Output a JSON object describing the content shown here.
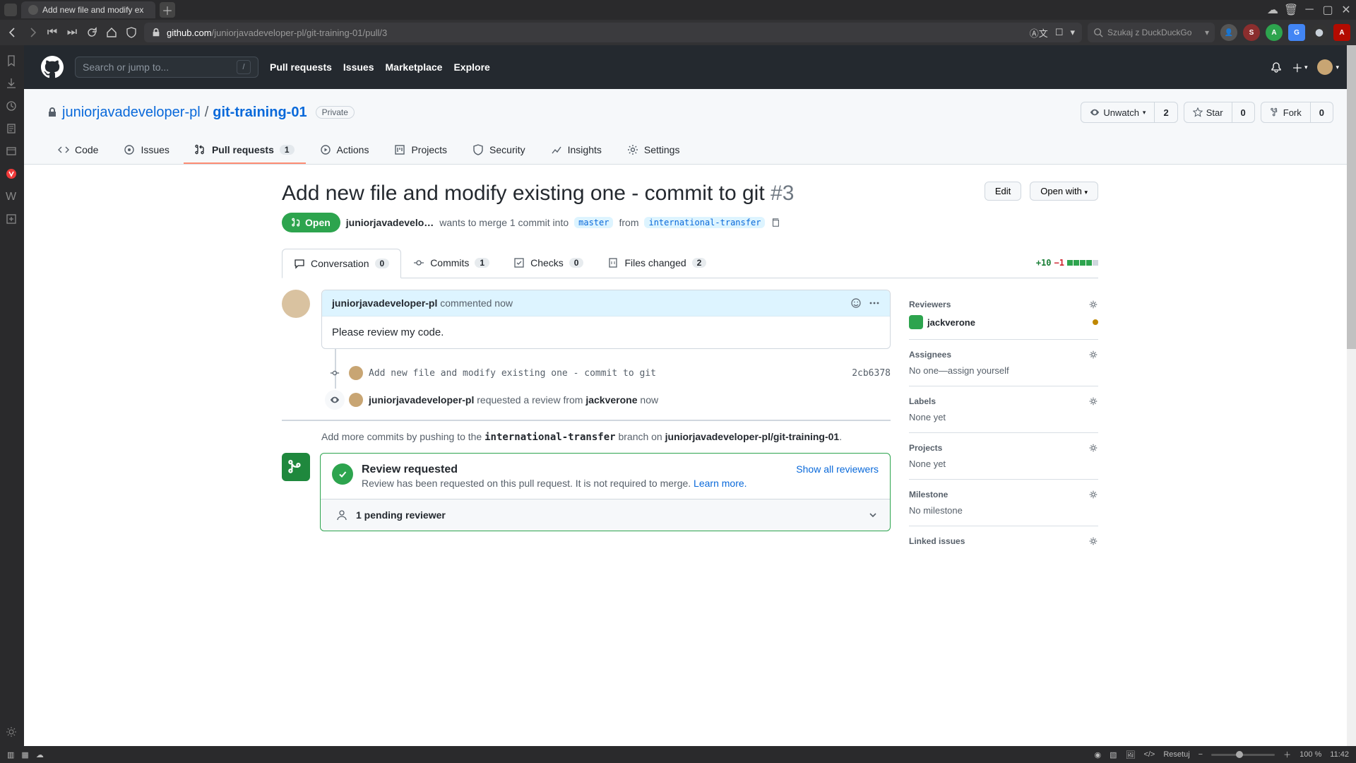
{
  "browser": {
    "tab_title": "Add new file and modify ex",
    "url_prefix": "github.com",
    "url_path": "/juniorjavadeveloper-pl/git-training-01/pull/3",
    "search_placeholder": "Szukaj z DuckDuckGo"
  },
  "gh": {
    "search_placeholder": "Search or jump to...",
    "nav": {
      "pulls": "Pull requests",
      "issues": "Issues",
      "marketplace": "Marketplace",
      "explore": "Explore"
    }
  },
  "repo": {
    "owner": "juniorjavadeveloper-pl",
    "name": "git-training-01",
    "visibility": "Private",
    "actions": {
      "unwatch": "Unwatch",
      "watch_count": "2",
      "star": "Star",
      "star_count": "0",
      "fork": "Fork",
      "fork_count": "0"
    },
    "tabs": {
      "code": "Code",
      "issues": "Issues",
      "pulls": "Pull requests",
      "pulls_count": "1",
      "actions": "Actions",
      "projects": "Projects",
      "security": "Security",
      "insights": "Insights",
      "settings": "Settings"
    }
  },
  "pr": {
    "title": "Add new file and modify existing one - commit to git",
    "number": "#3",
    "edit": "Edit",
    "open_with": "Open with",
    "state": "Open",
    "author": "juniorjavadevelo…",
    "merge_text1": "wants to merge 1 commit into",
    "base": "master",
    "from": "from",
    "head": "international-transfer",
    "tabs": {
      "conversation": "Conversation",
      "conversation_c": "0",
      "commits": "Commits",
      "commits_c": "1",
      "checks": "Checks",
      "checks_c": "0",
      "files": "Files changed",
      "files_c": "2"
    },
    "diff": {
      "add": "+10",
      "del": "−1"
    },
    "comment": {
      "author": "juniorjavadeveloper-pl",
      "meta": "commented now",
      "body": "Please review my code."
    },
    "commit": {
      "msg": "Add new file and modify existing one - commit to git",
      "sha": "2cb6378"
    },
    "review_event": {
      "actor": "juniorjavadeveloper-pl",
      "text": "requested a review from",
      "reviewer": "jackverone",
      "when": "now"
    },
    "push_hint_prefix": "Add more commits by pushing to the",
    "push_hint_branch": "international-transfer",
    "push_hint_mid": "branch on",
    "push_hint_repo": "juniorjavadeveloper-pl/git-training-01",
    "merge": {
      "title": "Review requested",
      "sub1": "Review has been requested on this pull request. It is not required to merge.",
      "learn": "Learn more.",
      "show": "Show all reviewers",
      "pending": "1 pending reviewer"
    }
  },
  "sidebar": {
    "reviewers": "Reviewers",
    "reviewer_name": "jackverone",
    "assignees": "Assignees",
    "assignees_val": "No one—assign yourself",
    "labels": "Labels",
    "labels_val": "None yet",
    "projects": "Projects",
    "projects_val": "None yet",
    "milestone": "Milestone",
    "milestone_val": "No milestone",
    "linked": "Linked issues"
  },
  "status": {
    "reset": "Resetuj",
    "zoom": "100 %",
    "time": "11:42"
  }
}
